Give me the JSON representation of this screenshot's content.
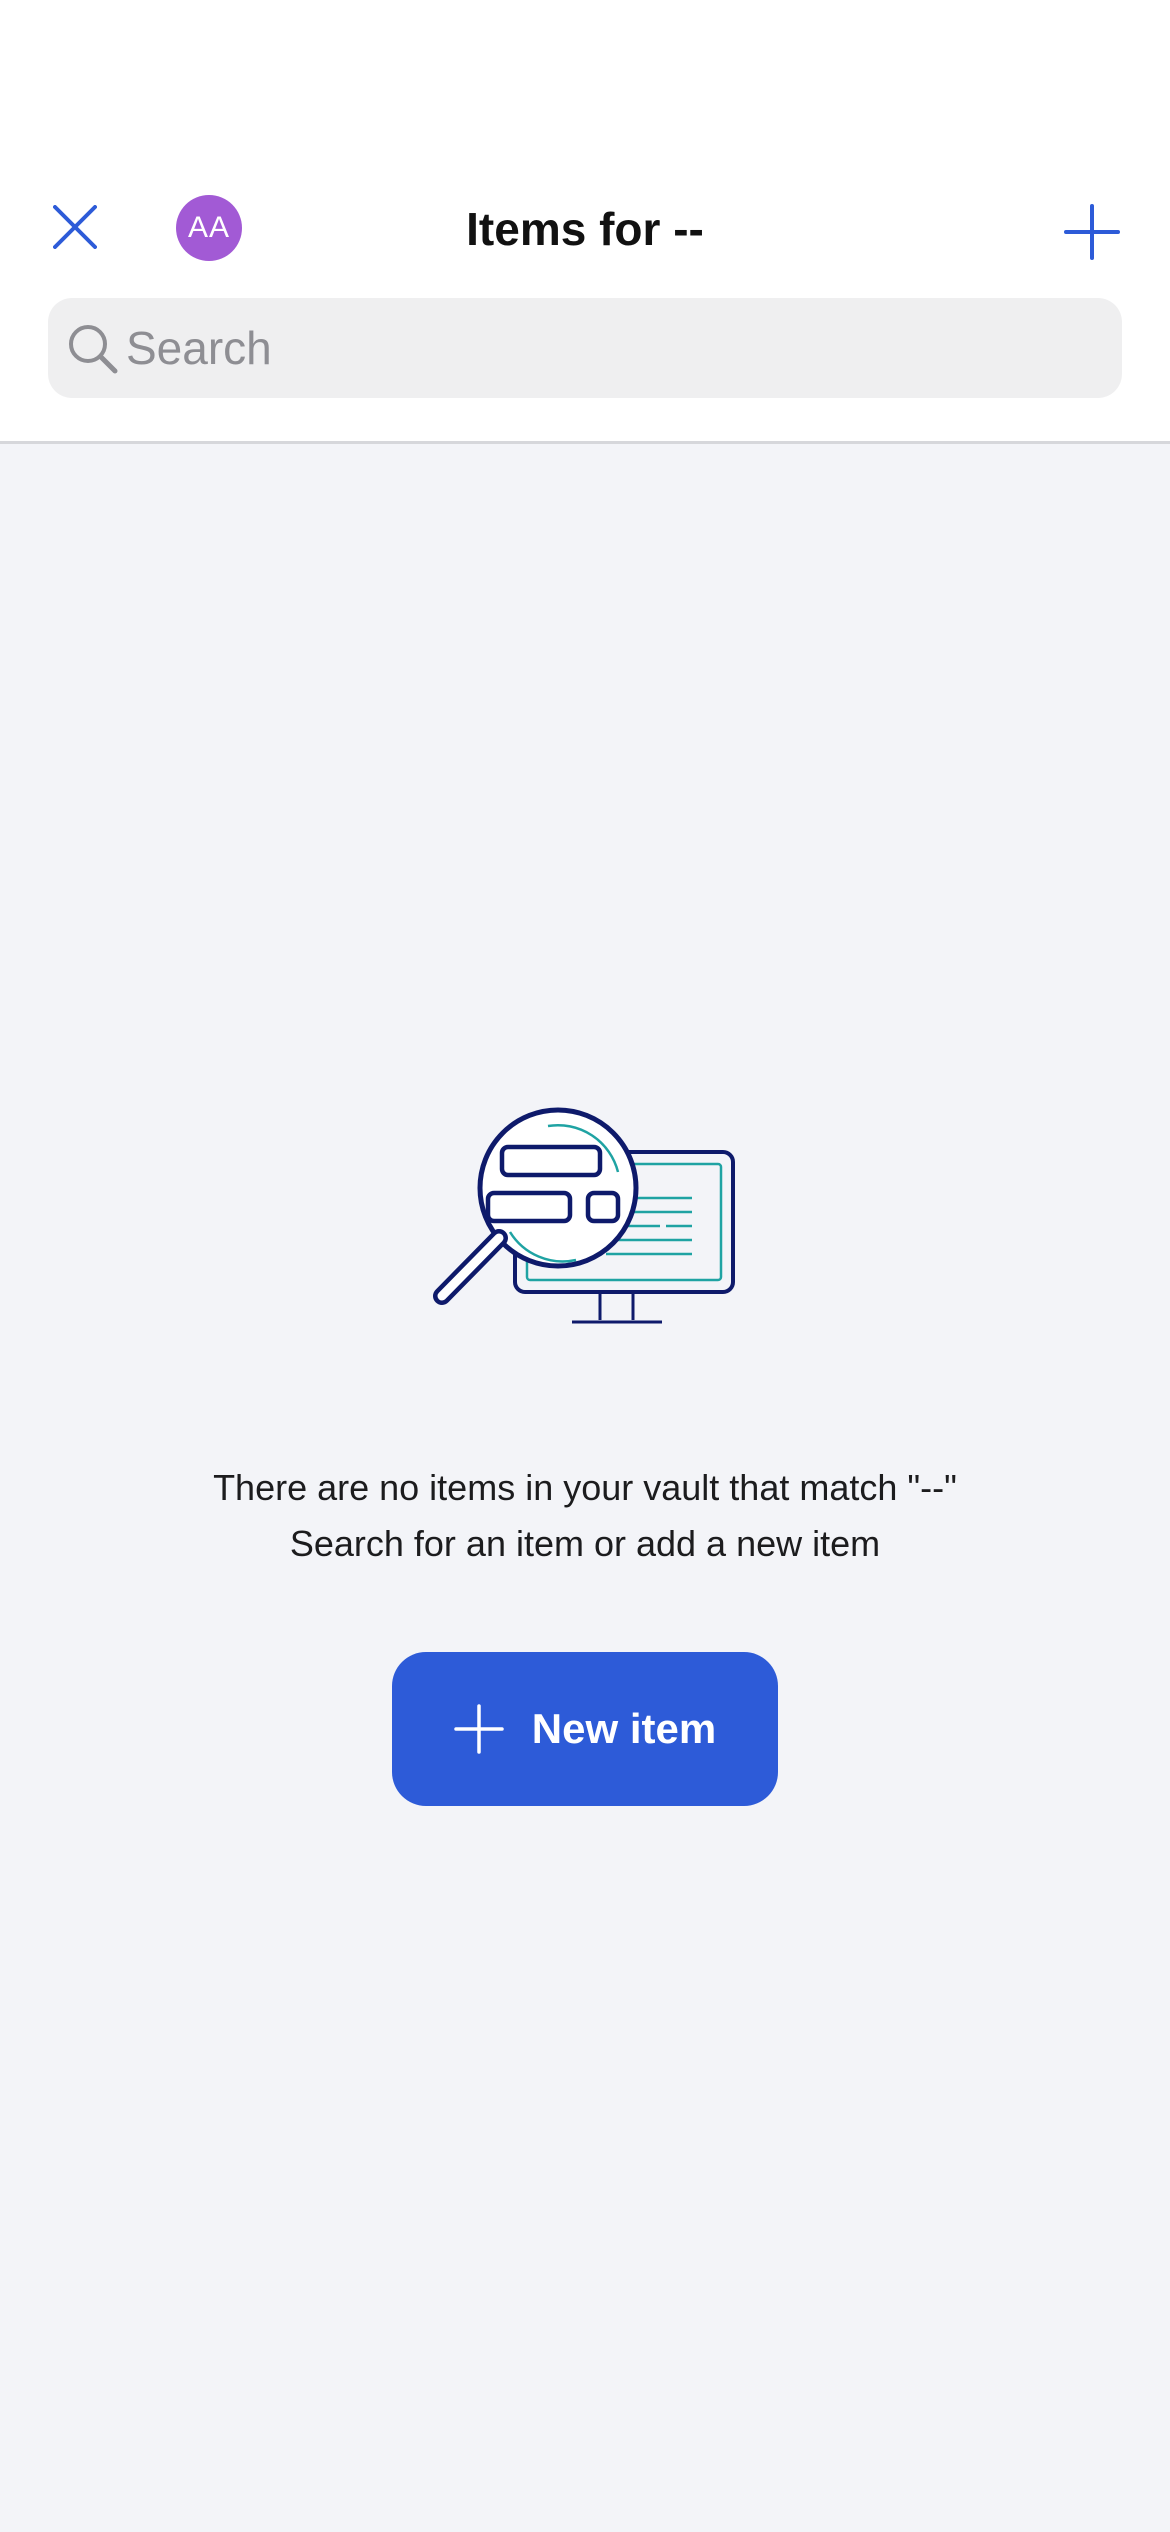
{
  "header": {
    "title": "Items for --",
    "avatar_initials": "AA",
    "avatar_color": "#a25ad5",
    "accent_color": "#2d5bd8",
    "close_icon": "close-icon",
    "add_icon": "plus-icon"
  },
  "search": {
    "placeholder": "Search",
    "value": "",
    "icon": "search-icon"
  },
  "empty_state": {
    "illustration": "magnifier-monitor-illustration",
    "line1": "There are no items in your vault that match \"--\"",
    "line2": "Search for an item or add a new item",
    "button_label": "New item",
    "button_color": "#2d5bd8"
  }
}
